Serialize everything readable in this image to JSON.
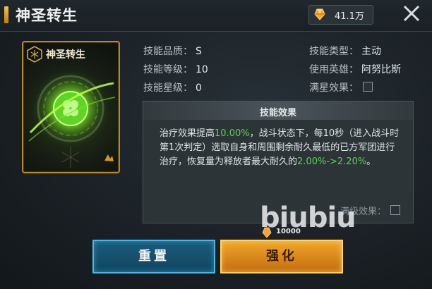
{
  "header": {
    "title": "神圣转生",
    "currency_value": "41.1万",
    "currency_icon": "gold-crystal-icon"
  },
  "skill_card": {
    "name": "神圣转生",
    "emblem_icon": "hexagon-emblem-icon",
    "art_icon": "green-clover-orb-icon"
  },
  "info": {
    "quality_label": "技能品质：",
    "quality_value": "S",
    "level_label": "技能等级：",
    "level_value": "10",
    "star_label": "技能星级：",
    "star_value": "0",
    "type_label": "技能类型：",
    "type_value": "主动",
    "hero_label": "使用英雄：",
    "hero_value": "阿努比斯",
    "full_star_label": "满星效果："
  },
  "effect": {
    "title": "技能效果",
    "text_1": "治疗效果提高",
    "hl_1": "10.00%",
    "text_2": "，战斗状态下，每10秒（进入战斗时第1次判定）选取自身和周围剩余耐久最低的已方军团进行治疗，恢复量为释放者最大耐久的",
    "hl_2": "2.00%->2.20%",
    "text_3": "。",
    "max_level_label": "满级效果："
  },
  "buttons": {
    "reset": "重置",
    "upgrade": "强化",
    "upgrade_cost": "10000"
  },
  "watermark": "biubiu",
  "colors": {
    "highlight": "#5ad05a",
    "reset_button": "#1a5b7a",
    "upgrade_button": "#f0a72a",
    "card_border": "#b7891e"
  }
}
